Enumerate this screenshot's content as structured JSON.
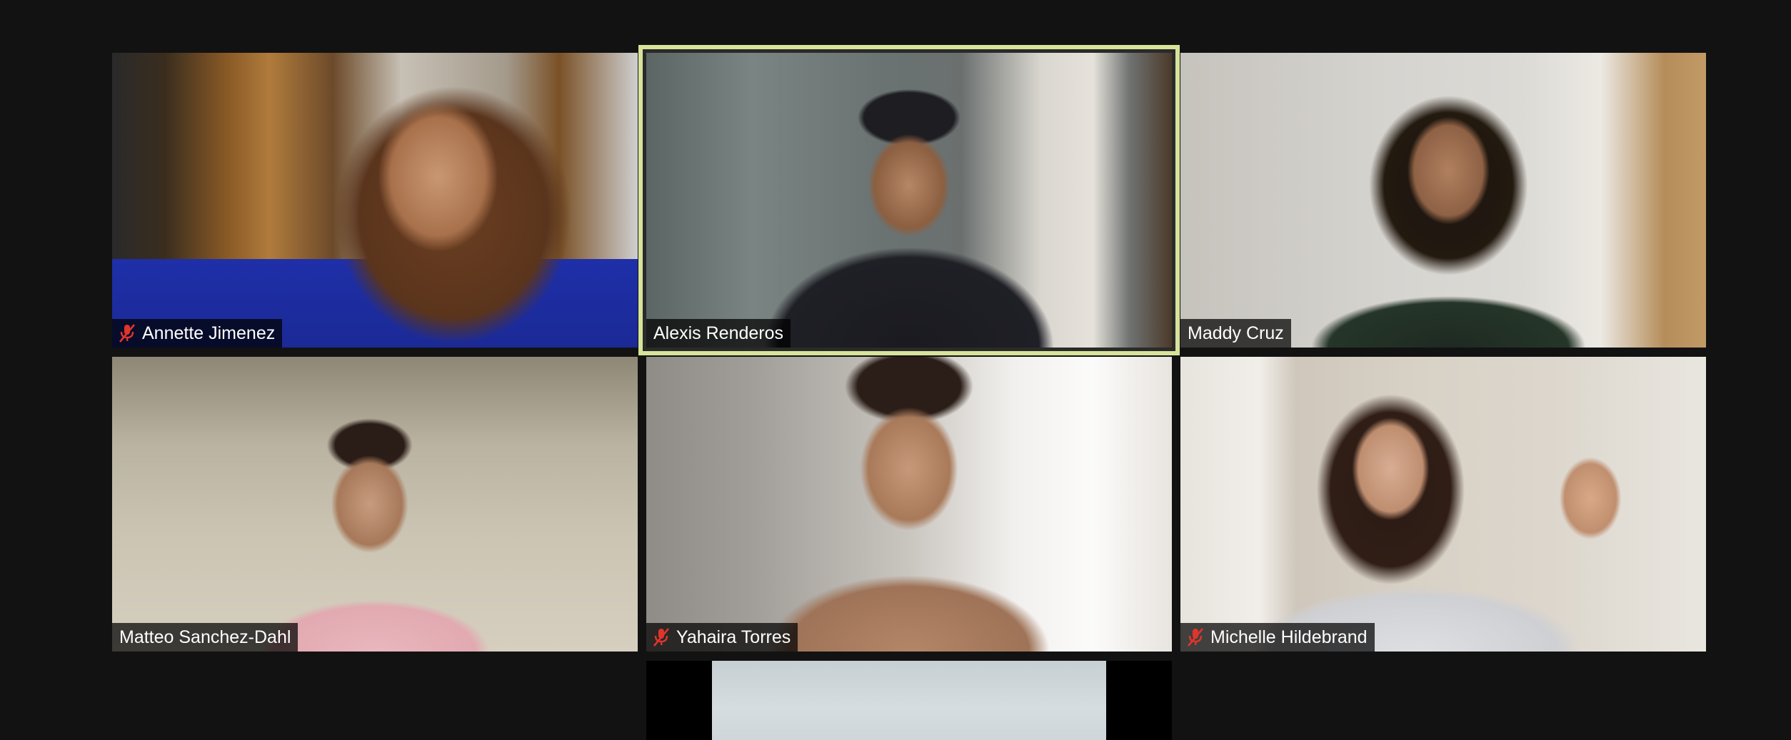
{
  "meeting": {
    "active_speaker": "Alexis Renderos",
    "participants": [
      {
        "name": "Annette Jimenez",
        "muted": true
      },
      {
        "name": "Alexis Renderos",
        "muted": false
      },
      {
        "name": "Maddy Cruz",
        "muted": false
      },
      {
        "name": "Matteo Sanchez-Dahl",
        "muted": false
      },
      {
        "name": "Yahaira Torres",
        "muted": true
      },
      {
        "name": "Michelle Hildebrand",
        "muted": true
      },
      {
        "name": "",
        "muted": false
      }
    ]
  },
  "icons": {
    "muted_mic": "muted-mic-icon"
  },
  "colors": {
    "background": "#121212",
    "active_speaker_border": "#d7e39a",
    "mute_red": "#e0352b",
    "name_text": "#ffffff"
  }
}
